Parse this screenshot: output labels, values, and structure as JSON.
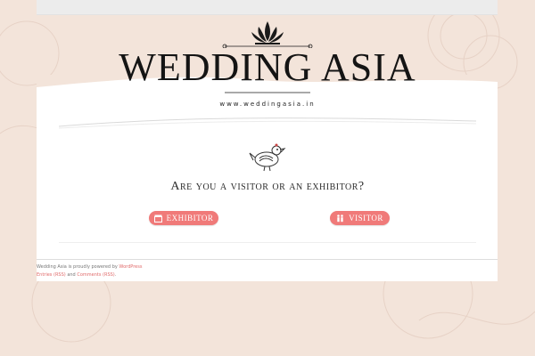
{
  "brand": {
    "title": "WEDDING ASIA",
    "url": "www.weddingasia.in"
  },
  "main": {
    "question": "Are you a visitor or an exhibitor?",
    "buttons": {
      "exhibitor": "EXHIBITOR",
      "visitor": "VISITOR"
    }
  },
  "footer": {
    "powered_prefix": "Wedding Asia is proudly powered by",
    "powered_link": "WordPress",
    "entries_link": "Entries (RSS)",
    "and_text": "and",
    "comments_link": "Comments (RSS)",
    "period": "."
  },
  "colors": {
    "background": "#f3e4da",
    "accent_button": "#f07a79",
    "link": "#e06a6a"
  },
  "icons": [
    "lotus-ornament-icon",
    "bird-icon",
    "booth-icon",
    "visitor-people-icon"
  ]
}
